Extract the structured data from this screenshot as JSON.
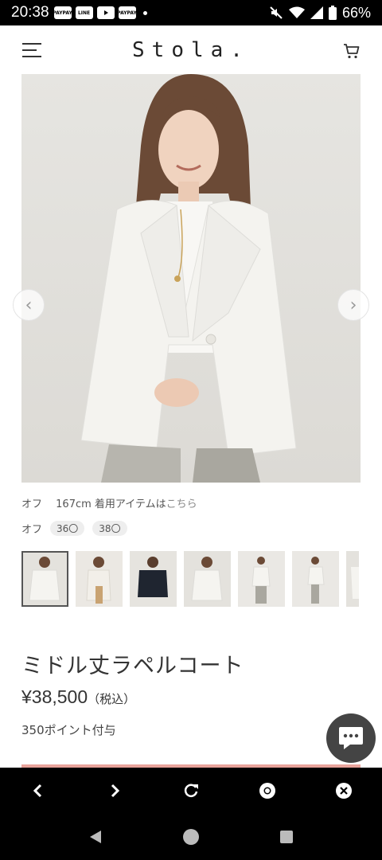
{
  "status_bar": {
    "time": "20:38",
    "battery": "66%",
    "app_icons": [
      "PAYPAY",
      "LINE",
      "YouTube",
      "PAYPAY"
    ]
  },
  "header": {
    "logo": "Stola."
  },
  "gallery": {
    "prev_label": "‹",
    "next_label": "›",
    "thumbnail_count": 7
  },
  "model_info": {
    "color": "オフ",
    "height": "167cm",
    "text": "着用アイテムは",
    "link": "こちら"
  },
  "sizes": {
    "color": "オフ",
    "items": [
      "36〇",
      "38〇"
    ]
  },
  "product": {
    "name": "ミドル丈ラペルコート",
    "price": "¥38,500",
    "tax": "（税込）",
    "points": "350ポイント付与"
  },
  "colors": {
    "accent_strip": "#e8a39b",
    "chat_button": "#444444"
  }
}
